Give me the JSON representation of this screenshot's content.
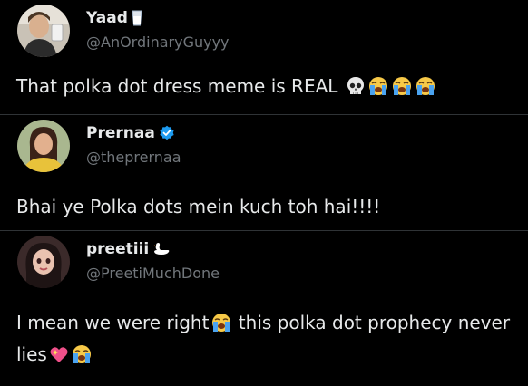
{
  "tweets": [
    {
      "name": "Yaad",
      "name_emoji": "glass-of-milk-icon",
      "handle": "@AnOrdinaryGuyyy",
      "text": "That polka dot dress meme is REAL",
      "trailing_emojis": [
        "skull-icon",
        "loudly-crying-face-icon",
        "loudly-crying-face-icon",
        "loudly-crying-face-icon"
      ]
    },
    {
      "name": "Prernaa",
      "verified": true,
      "handle": "@theprernaa",
      "text": "Bhai ye Polka dots mein kuch toh hai!!!!"
    },
    {
      "name": "preetiii",
      "name_emoji": "swan-icon",
      "handle": "@PreetiMuchDone",
      "text_part1": "I mean we were right",
      "text_part2": " this polka dot prophecy never lies"
    }
  ],
  "colors": {
    "background": "#000000",
    "text_primary": "#e7e9ea",
    "text_secondary": "#71767b",
    "divider": "#2f3336",
    "verified_blue": "#1d9bf0"
  }
}
